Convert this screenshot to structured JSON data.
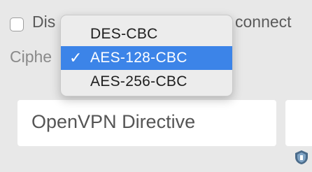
{
  "checkbox_row": {
    "label_start": "Dis",
    "label_end": "connect",
    "checked": false
  },
  "cipher": {
    "label": "Ciphe",
    "options": [
      {
        "label": "DES-CBC",
        "selected": false
      },
      {
        "label": "AES-128-CBC",
        "selected": true
      },
      {
        "label": "AES-256-CBC",
        "selected": false
      }
    ],
    "check_mark": "✓"
  },
  "directive_field": {
    "placeholder": "OpenVPN Directive"
  },
  "colors": {
    "selection": "#3c84e8",
    "background": "#e8e8e8"
  },
  "icons": [
    "check-icon",
    "shield-icon"
  ]
}
